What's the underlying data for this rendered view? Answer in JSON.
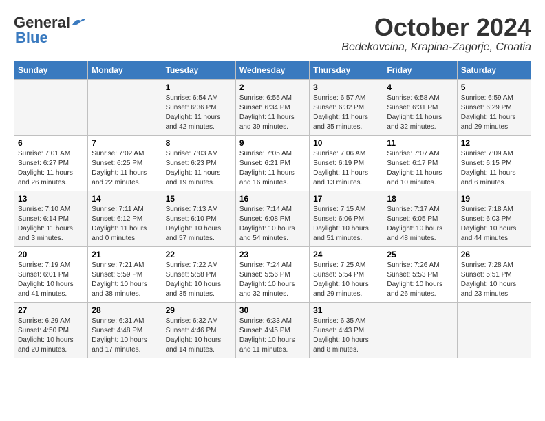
{
  "header": {
    "logo_general": "General",
    "logo_blue": "Blue",
    "month_year": "October 2024",
    "location": "Bedekovcina, Krapina-Zagorje, Croatia"
  },
  "weekdays": [
    "Sunday",
    "Monday",
    "Tuesday",
    "Wednesday",
    "Thursday",
    "Friday",
    "Saturday"
  ],
  "weeks": [
    [
      {
        "day": "",
        "sunrise": "",
        "sunset": "",
        "daylight": ""
      },
      {
        "day": "",
        "sunrise": "",
        "sunset": "",
        "daylight": ""
      },
      {
        "day": "1",
        "sunrise": "Sunrise: 6:54 AM",
        "sunset": "Sunset: 6:36 PM",
        "daylight": "Daylight: 11 hours and 42 minutes."
      },
      {
        "day": "2",
        "sunrise": "Sunrise: 6:55 AM",
        "sunset": "Sunset: 6:34 PM",
        "daylight": "Daylight: 11 hours and 39 minutes."
      },
      {
        "day": "3",
        "sunrise": "Sunrise: 6:57 AM",
        "sunset": "Sunset: 6:32 PM",
        "daylight": "Daylight: 11 hours and 35 minutes."
      },
      {
        "day": "4",
        "sunrise": "Sunrise: 6:58 AM",
        "sunset": "Sunset: 6:31 PM",
        "daylight": "Daylight: 11 hours and 32 minutes."
      },
      {
        "day": "5",
        "sunrise": "Sunrise: 6:59 AM",
        "sunset": "Sunset: 6:29 PM",
        "daylight": "Daylight: 11 hours and 29 minutes."
      }
    ],
    [
      {
        "day": "6",
        "sunrise": "Sunrise: 7:01 AM",
        "sunset": "Sunset: 6:27 PM",
        "daylight": "Daylight: 11 hours and 26 minutes."
      },
      {
        "day": "7",
        "sunrise": "Sunrise: 7:02 AM",
        "sunset": "Sunset: 6:25 PM",
        "daylight": "Daylight: 11 hours and 22 minutes."
      },
      {
        "day": "8",
        "sunrise": "Sunrise: 7:03 AM",
        "sunset": "Sunset: 6:23 PM",
        "daylight": "Daylight: 11 hours and 19 minutes."
      },
      {
        "day": "9",
        "sunrise": "Sunrise: 7:05 AM",
        "sunset": "Sunset: 6:21 PM",
        "daylight": "Daylight: 11 hours and 16 minutes."
      },
      {
        "day": "10",
        "sunrise": "Sunrise: 7:06 AM",
        "sunset": "Sunset: 6:19 PM",
        "daylight": "Daylight: 11 hours and 13 minutes."
      },
      {
        "day": "11",
        "sunrise": "Sunrise: 7:07 AM",
        "sunset": "Sunset: 6:17 PM",
        "daylight": "Daylight: 11 hours and 10 minutes."
      },
      {
        "day": "12",
        "sunrise": "Sunrise: 7:09 AM",
        "sunset": "Sunset: 6:15 PM",
        "daylight": "Daylight: 11 hours and 6 minutes."
      }
    ],
    [
      {
        "day": "13",
        "sunrise": "Sunrise: 7:10 AM",
        "sunset": "Sunset: 6:14 PM",
        "daylight": "Daylight: 11 hours and 3 minutes."
      },
      {
        "day": "14",
        "sunrise": "Sunrise: 7:11 AM",
        "sunset": "Sunset: 6:12 PM",
        "daylight": "Daylight: 11 hours and 0 minutes."
      },
      {
        "day": "15",
        "sunrise": "Sunrise: 7:13 AM",
        "sunset": "Sunset: 6:10 PM",
        "daylight": "Daylight: 10 hours and 57 minutes."
      },
      {
        "day": "16",
        "sunrise": "Sunrise: 7:14 AM",
        "sunset": "Sunset: 6:08 PM",
        "daylight": "Daylight: 10 hours and 54 minutes."
      },
      {
        "day": "17",
        "sunrise": "Sunrise: 7:15 AM",
        "sunset": "Sunset: 6:06 PM",
        "daylight": "Daylight: 10 hours and 51 minutes."
      },
      {
        "day": "18",
        "sunrise": "Sunrise: 7:17 AM",
        "sunset": "Sunset: 6:05 PM",
        "daylight": "Daylight: 10 hours and 48 minutes."
      },
      {
        "day": "19",
        "sunrise": "Sunrise: 7:18 AM",
        "sunset": "Sunset: 6:03 PM",
        "daylight": "Daylight: 10 hours and 44 minutes."
      }
    ],
    [
      {
        "day": "20",
        "sunrise": "Sunrise: 7:19 AM",
        "sunset": "Sunset: 6:01 PM",
        "daylight": "Daylight: 10 hours and 41 minutes."
      },
      {
        "day": "21",
        "sunrise": "Sunrise: 7:21 AM",
        "sunset": "Sunset: 5:59 PM",
        "daylight": "Daylight: 10 hours and 38 minutes."
      },
      {
        "day": "22",
        "sunrise": "Sunrise: 7:22 AM",
        "sunset": "Sunset: 5:58 PM",
        "daylight": "Daylight: 10 hours and 35 minutes."
      },
      {
        "day": "23",
        "sunrise": "Sunrise: 7:24 AM",
        "sunset": "Sunset: 5:56 PM",
        "daylight": "Daylight: 10 hours and 32 minutes."
      },
      {
        "day": "24",
        "sunrise": "Sunrise: 7:25 AM",
        "sunset": "Sunset: 5:54 PM",
        "daylight": "Daylight: 10 hours and 29 minutes."
      },
      {
        "day": "25",
        "sunrise": "Sunrise: 7:26 AM",
        "sunset": "Sunset: 5:53 PM",
        "daylight": "Daylight: 10 hours and 26 minutes."
      },
      {
        "day": "26",
        "sunrise": "Sunrise: 7:28 AM",
        "sunset": "Sunset: 5:51 PM",
        "daylight": "Daylight: 10 hours and 23 minutes."
      }
    ],
    [
      {
        "day": "27",
        "sunrise": "Sunrise: 6:29 AM",
        "sunset": "Sunset: 4:50 PM",
        "daylight": "Daylight: 10 hours and 20 minutes."
      },
      {
        "day": "28",
        "sunrise": "Sunrise: 6:31 AM",
        "sunset": "Sunset: 4:48 PM",
        "daylight": "Daylight: 10 hours and 17 minutes."
      },
      {
        "day": "29",
        "sunrise": "Sunrise: 6:32 AM",
        "sunset": "Sunset: 4:46 PM",
        "daylight": "Daylight: 10 hours and 14 minutes."
      },
      {
        "day": "30",
        "sunrise": "Sunrise: 6:33 AM",
        "sunset": "Sunset: 4:45 PM",
        "daylight": "Daylight: 10 hours and 11 minutes."
      },
      {
        "day": "31",
        "sunrise": "Sunrise: 6:35 AM",
        "sunset": "Sunset: 4:43 PM",
        "daylight": "Daylight: 10 hours and 8 minutes."
      },
      {
        "day": "",
        "sunrise": "",
        "sunset": "",
        "daylight": ""
      },
      {
        "day": "",
        "sunrise": "",
        "sunset": "",
        "daylight": ""
      }
    ]
  ]
}
